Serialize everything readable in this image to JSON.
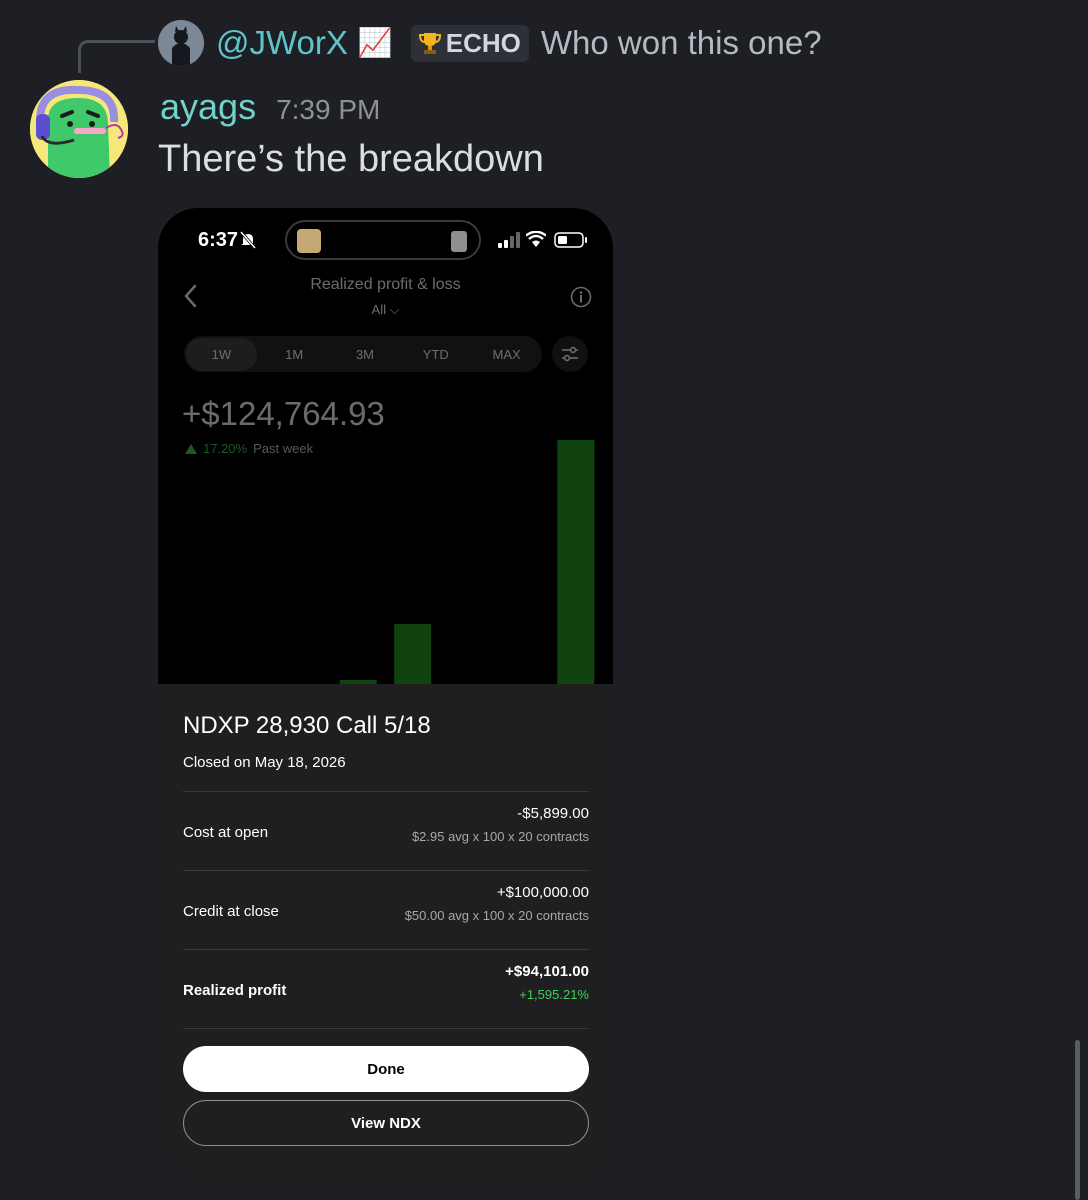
{
  "reply": {
    "username": "@JWorX",
    "username_emoji": "📈",
    "tag_icon": "trophy-icon",
    "tag_label": "ECHO",
    "text": "Who won this one?"
  },
  "message": {
    "username": "ayags",
    "timestamp": "7:39 PM",
    "text": "There’s the breakdown"
  },
  "phone": {
    "status": {
      "time": "6:37"
    },
    "app": {
      "title": "Realized profit & loss",
      "filter": "All ⌵",
      "tabs": [
        {
          "label": "1W",
          "active": true
        },
        {
          "label": "1M"
        },
        {
          "label": "3M"
        },
        {
          "label": "YTD"
        },
        {
          "label": "MAX"
        }
      ],
      "total": "+$124,764.93",
      "change_pct": "17.20%",
      "change_period": "Past week"
    },
    "chart_data": {
      "type": "bar",
      "title": "",
      "xlabel": "",
      "ylabel": "",
      "color": "#1e7a1e",
      "values": [
        0,
        0,
        0,
        0.5,
        7.5,
        0,
        0,
        30.5
      ],
      "ylim": [
        0,
        32
      ]
    },
    "sheet": {
      "title": "NDXP 28,930 Call 5/18",
      "closed": "Closed on May 18, 2026",
      "rows": [
        {
          "label": "Cost at open",
          "value": "-$5,899.00",
          "detail": "$2.95 avg x 100 x 20 contracts"
        },
        {
          "label": "Credit at close",
          "value": "+$100,000.00",
          "detail": "$50.00 avg x 100 x 20 contracts"
        },
        {
          "label": "Realized profit",
          "value": "+$94,101.00",
          "detail": "+1,595.21%"
        }
      ],
      "done_label": "Done",
      "view_label": "View NDX"
    }
  },
  "colors": {
    "background": "#1e1f24",
    "username": "#6fd3c8",
    "reply_name": "#5ec4c9",
    "profit_green": "#3fd15a"
  }
}
